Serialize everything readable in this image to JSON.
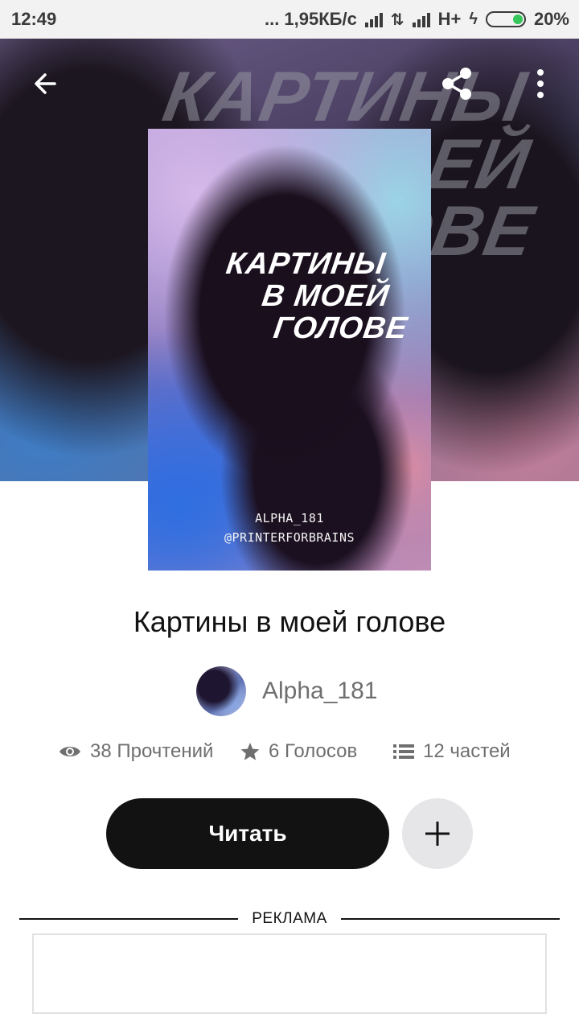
{
  "status_bar": {
    "time": "12:49",
    "network_speed": "... 1,95КБ/с",
    "network_type": "H+",
    "battery": "20%"
  },
  "header": {
    "background_title_lines": [
      "КАРТИНЫ",
      "В МОЕЙ",
      "ГОЛОВЕ"
    ],
    "icons": [
      "back-arrow-icon",
      "share-icon",
      "more-vert-icon"
    ]
  },
  "cover": {
    "title_lines": [
      "КАРТИНЫ",
      "В МОЕЙ",
      "ГОЛОВЕ"
    ],
    "credit_author": "ALPHA_181",
    "credit_designer": "@PRINTERFORBRAINS"
  },
  "book": {
    "title": "Картины в моей голове",
    "author": "Alpha_181"
  },
  "stats": {
    "reads": "38 Прочтений",
    "votes": "6 Голосов",
    "parts": "12 частей"
  },
  "actions": {
    "read_label": "Читать",
    "add_icon": "plus-icon"
  },
  "ad": {
    "label": "РЕКЛАМА"
  },
  "colors": {
    "primary_button": "#121212",
    "secondary_button": "#e6e6e8",
    "muted_text": "#6f6f6f",
    "battery_green": "#35c759"
  }
}
